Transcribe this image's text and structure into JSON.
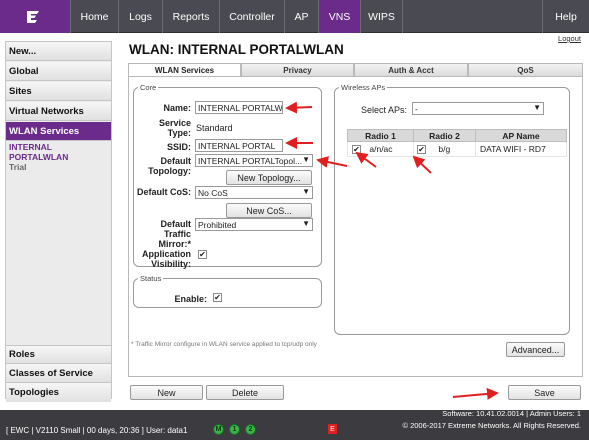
{
  "nav": {
    "logo_icon": "extreme-logo-icon",
    "tabs": [
      "Home",
      "Logs",
      "Reports",
      "Controller",
      "AP",
      "VNS",
      "WIPS"
    ],
    "active_tab": "VNS",
    "help": "Help",
    "logout": "Logout"
  },
  "sidebar": {
    "items": [
      "New...",
      "Global",
      "Sites",
      "Virtual Networks",
      "WLAN Services",
      "Roles",
      "Classes of Service",
      "Topologies"
    ],
    "active": "WLAN Services",
    "sub_item": "INTERNAL PORTALWLAN",
    "sub_item_note": "Trial"
  },
  "page": {
    "title": "WLAN: INTERNAL PORTALWLAN",
    "tabs": [
      "WLAN Services",
      "Privacy",
      "Auth & Acct",
      "QoS"
    ],
    "active_tab": "WLAN Services"
  },
  "core": {
    "legend": "Core",
    "name_label": "Name:",
    "name_value": "INTERNAL PORTALWL",
    "service_type_label": "Service Type:",
    "service_type_value": "Standard",
    "ssid_label": "SSID:",
    "ssid_value": "INTERNAL PORTAL",
    "topology_label": "Default Topology:",
    "topology_value": "INTERNAL PORTALTopol...",
    "new_topology_button": "New Topology...",
    "cos_label": "Default CoS:",
    "cos_value": "No CoS",
    "new_cos_button": "New CoS...",
    "mirror_label": "Default Traffic Mirror:*",
    "mirror_value": "Prohibited",
    "app_visibility_label": "Application Visibility:",
    "app_visibility_checked": true
  },
  "status": {
    "legend": "Status",
    "enable_label": "Enable:",
    "enable_checked": true
  },
  "wireless_aps": {
    "legend": "Wireless APs",
    "select_label": "Select APs:",
    "select_value": "-",
    "columns": [
      "Radio 1",
      "Radio 2",
      "AP Name"
    ],
    "rows": [
      {
        "radio1": "a/n/ac",
        "radio1_checked": true,
        "radio2": "b/g",
        "radio2_checked": true,
        "ap_name": "DATA WIFI - RD7"
      }
    ],
    "advanced_button": "Advanced..."
  },
  "footnote": "* Traffic Mirror configure in WLAN service applied to tcp/udp only",
  "actions": {
    "new": "New",
    "delete": "Delete",
    "save": "Save"
  },
  "statusbar": {
    "left": "[ EWC | V2110 Small | 00 days, 20:36 ]  User: data1",
    "leds": [
      "M",
      "1",
      "2"
    ],
    "error_badge": "E",
    "software": "Software: 10.41.02.0014 | Admin Users: 1",
    "copyright": "© 2006-2017  Extreme Networks. All Rights Reserved."
  },
  "colors": {
    "brand_purple": "#6a2b8a",
    "nav_bg": "#4a4a52",
    "annotation_red": "#e02020"
  }
}
